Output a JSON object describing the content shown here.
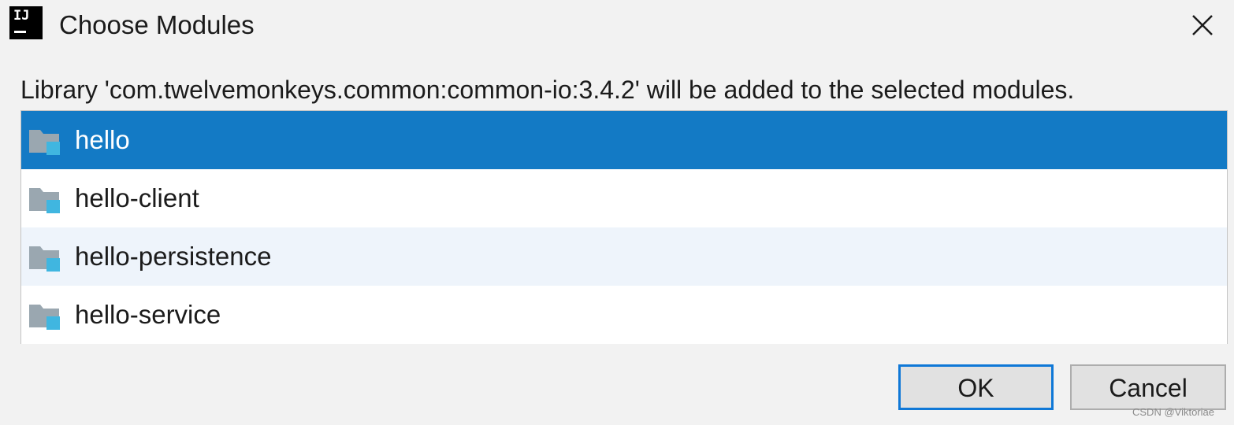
{
  "window": {
    "title": "Choose Modules",
    "app_icon_text": "IJ",
    "close_icon": "close-icon"
  },
  "message": "Library 'com.twelvemonkeys.common:common-io:3.4.2' will be added to the selected modules.",
  "modules": [
    {
      "label": "hello",
      "icon": "module-folder-icon",
      "selected": true
    },
    {
      "label": "hello-client",
      "icon": "module-folder-icon",
      "selected": false
    },
    {
      "label": "hello-persistence",
      "icon": "module-folder-icon",
      "selected": false
    },
    {
      "label": "hello-service",
      "icon": "module-folder-icon",
      "selected": false
    }
  ],
  "buttons": {
    "ok_label": "OK",
    "cancel_label": "Cancel"
  },
  "watermark": "CSDN @Viktoriae",
  "colors": {
    "selection": "#137ac5",
    "alt_row": "#eef4fb",
    "folder_gray": "#9aa7b0",
    "module_accent": "#40b6e0",
    "default_button_border": "#0f78d7"
  }
}
